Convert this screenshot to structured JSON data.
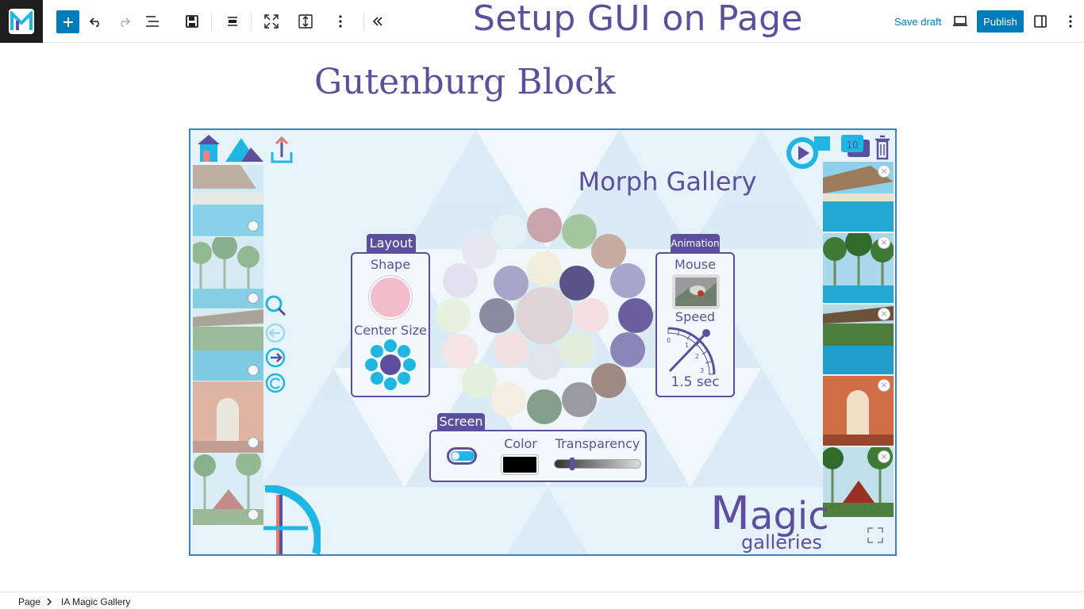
{
  "toolbar": {
    "overlay_title": "Setup GUI on Page",
    "save_draft_label": "Save draft",
    "publish_label": "Publish"
  },
  "page": {
    "title": "Gutenburg Block"
  },
  "gallery": {
    "title": "Morph Gallery",
    "layout_panel": {
      "tag": "Layout",
      "shape_label": "Shape",
      "center_size_label": "Center Size"
    },
    "animation_panel": {
      "tag": "Animation",
      "mouse_label": "Mouse",
      "speed_label": "Speed",
      "speed_value": "1.5 sec",
      "dial_ticks": [
        "0",
        "1",
        "2",
        "3"
      ]
    },
    "screen_panel": {
      "tag": "Screen",
      "color_label": "Color",
      "transparency_label": "Transparency",
      "toggle_on": true,
      "transparency_level": 0.18,
      "color_value": "#000000"
    },
    "counter_badge": "10",
    "brand": {
      "magic_M": "M",
      "magic_rest": "agic",
      "galleries": "galleries"
    }
  },
  "footer": {
    "breadcrumb": [
      "Page",
      "IA Magic Gallery"
    ]
  },
  "colors": {
    "accent": "#007cba",
    "brand_purple": "#5b4f9e",
    "brand_cyan": "#1fb6e4",
    "block_border": "#3582c4"
  }
}
